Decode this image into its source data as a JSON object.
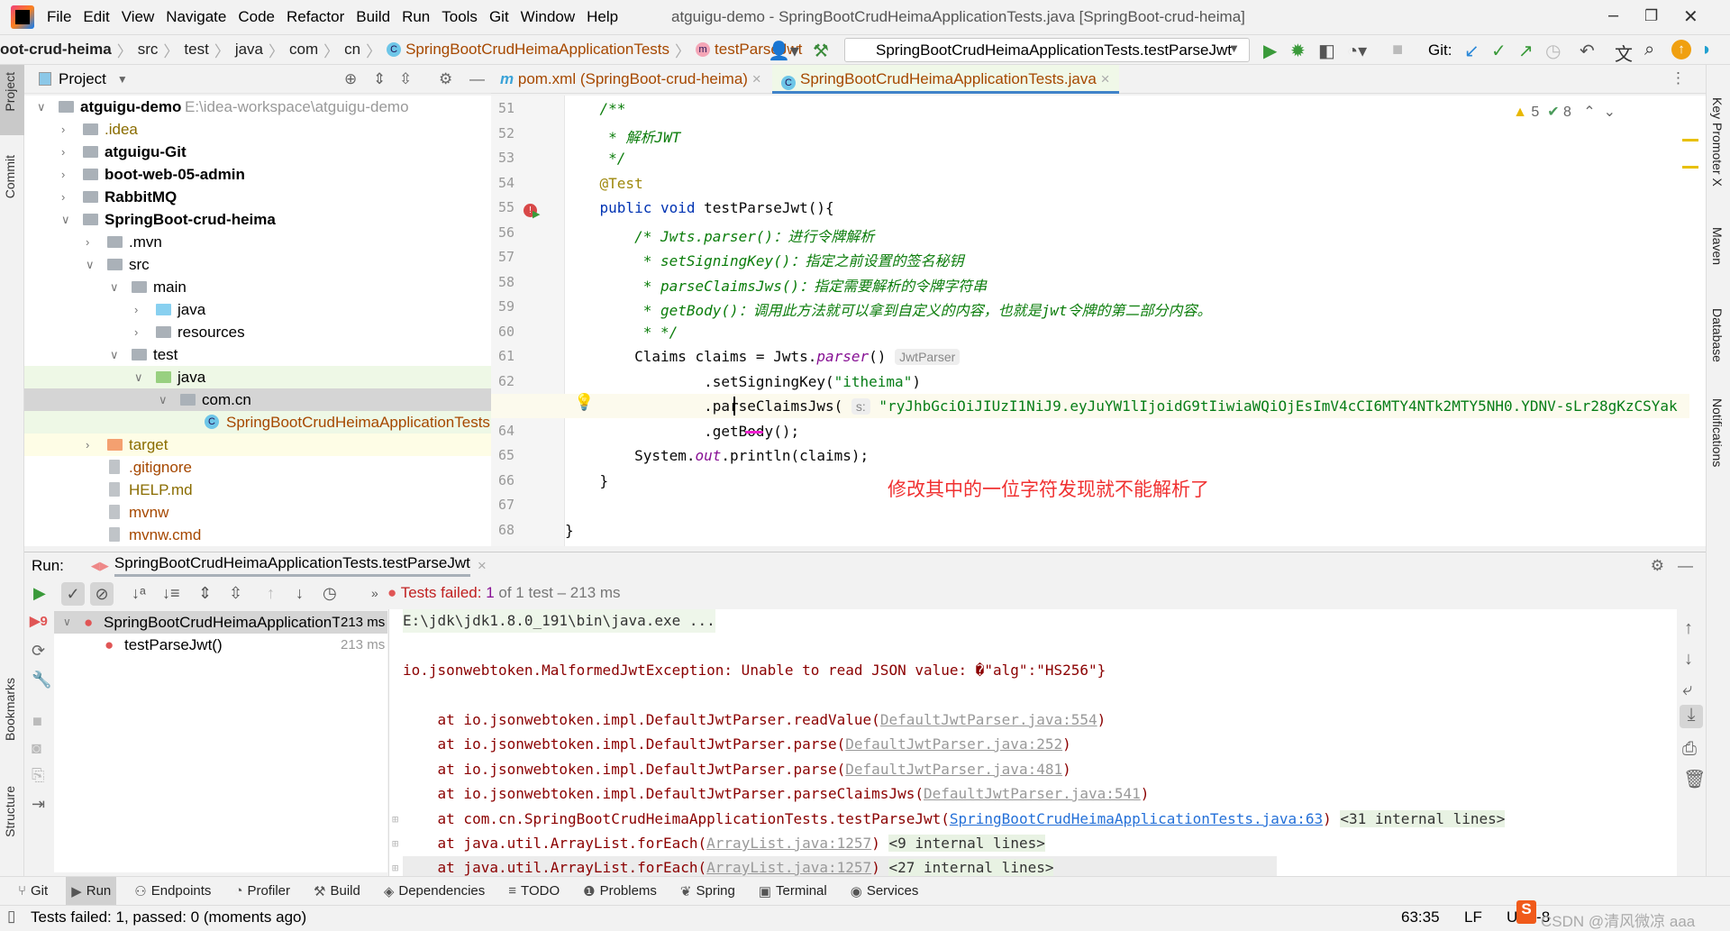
{
  "window": {
    "title": "atguigu-demo - SpringBootCrudHeimaApplicationTests.java [SpringBoot-crud-heima]"
  },
  "menu": [
    "File",
    "Edit",
    "View",
    "Navigate",
    "Code",
    "Refactor",
    "Build",
    "Run",
    "Tools",
    "Git",
    "Window",
    "Help"
  ],
  "breadcrumb": [
    "oot-crud-heima",
    "src",
    "test",
    "java",
    "com",
    "cn",
    "SpringBootCrudHeimaApplicationTests",
    "testParseJwt"
  ],
  "toolbar": {
    "run_config": "SpringBootCrudHeimaApplicationTests.testParseJwt",
    "git_label": "Git:"
  },
  "project": {
    "header": "Project",
    "tree": [
      {
        "label": "atguigu-demo",
        "path": "E:\\idea-workspace\\atguigu-demo",
        "depth": 0,
        "expanded": true,
        "bold": true,
        "icon": "module"
      },
      {
        "label": ".idea",
        "depth": 1,
        "expanded": false,
        "icon": "folder",
        "color": "#8a6c00"
      },
      {
        "label": "atguigu-Git",
        "depth": 1,
        "expanded": false,
        "bold": true,
        "icon": "module"
      },
      {
        "label": "boot-web-05-admin",
        "depth": 1,
        "expanded": false,
        "bold": true,
        "icon": "module"
      },
      {
        "label": "RabbitMQ",
        "depth": 1,
        "expanded": false,
        "bold": true,
        "icon": "module"
      },
      {
        "label": "SpringBoot-crud-heima",
        "depth": 1,
        "expanded": true,
        "bold": true,
        "icon": "module"
      },
      {
        "label": ".mvn",
        "depth": 2,
        "expanded": false,
        "icon": "folder"
      },
      {
        "label": "src",
        "depth": 2,
        "expanded": true,
        "icon": "folder"
      },
      {
        "label": "main",
        "depth": 3,
        "expanded": true,
        "icon": "folder"
      },
      {
        "label": "java",
        "depth": 4,
        "expanded": false,
        "icon": "source-folder"
      },
      {
        "label": "resources",
        "depth": 4,
        "expanded": false,
        "icon": "resources-folder"
      },
      {
        "label": "test",
        "depth": 3,
        "expanded": true,
        "icon": "folder"
      },
      {
        "label": "java",
        "depth": 4,
        "expanded": true,
        "icon": "test-folder",
        "bg": "#eef8e6"
      },
      {
        "label": "com.cn",
        "depth": 5,
        "expanded": true,
        "icon": "package",
        "bg": "#d5d5d5"
      },
      {
        "label": "SpringBootCrudHeimaApplicationTests",
        "depth": 6,
        "icon": "class",
        "color": "#a64800",
        "bg": "#eef8e6"
      },
      {
        "label": "target",
        "depth": 2,
        "expanded": false,
        "icon": "excluded-folder",
        "bg": "#fefde6",
        "color": "#8a6c00"
      },
      {
        "label": ".gitignore",
        "depth": 2,
        "icon": "file",
        "color": "#a64800"
      },
      {
        "label": "HELP.md",
        "depth": 2,
        "icon": "md-file",
        "color": "#8a6c00"
      },
      {
        "label": "mvnw",
        "depth": 2,
        "icon": "script-file",
        "color": "#a64800"
      },
      {
        "label": "mvnw.cmd",
        "depth": 2,
        "icon": "file",
        "color": "#a64800"
      }
    ]
  },
  "editor": {
    "tabs": [
      {
        "label": "pom.xml (SpringBoot-crud-heima)",
        "active": false
      },
      {
        "label": "SpringBootCrudHeimaApplicationTests.java",
        "active": true
      }
    ],
    "warnings": "5",
    "weak_warnings": "8",
    "line_numbers": [
      "51",
      "52",
      "53",
      "54",
      "55",
      "56",
      "57",
      "58",
      "59",
      "60",
      "61",
      "62",
      "63",
      "64",
      "65",
      "66",
      "67",
      "68"
    ],
    "code": {
      "l51": "/**",
      "l52": " * 解析JWT",
      "l53": " */",
      "l54": "@Test",
      "l55a": "public void ",
      "l55b": "testParseJwt(){",
      "l56": "    /* Jwts.parser()：进行令牌解析",
      "l57": "     * setSigningKey()：指定之前设置的签名秘钥",
      "l58": "     * parseClaimsJws()：指定需要解析的令牌字符串",
      "l59": "     * getBody()：调用此方法就可以拿到自定义的内容，也就是jwt令牌的第二部分内容。",
      "l60": "     * */",
      "l61a": "    Claims claims = Jwts.",
      "l61b": "parser",
      "l61c": "()",
      "l61hint": "JwtParser",
      "l62a": "            .setSigningKey(",
      "l62b": "\"itheima\"",
      "l62c": ")",
      "l63a": "            .parseClaimsJws(",
      "l63hint": "s:",
      "l63b": "\"ryJhbGciOiJIUzI1NiJ9.eyJuYW1lIjoidG9tIiwiaWQiOjEsImV4cCI6MTY4NTk2MTY5NH0.YDNV-sLr28gKzCSYak",
      "l64": "            .getBody();",
      "l65a": "    System.",
      "l65b": "out",
      "l65c": ".println(claims);",
      "l66": "}",
      "l68": "}"
    },
    "annotation_note": "修改其中的一位字符发现就不能解析了"
  },
  "run": {
    "label": "Run:",
    "tab": "SpringBootCrudHeimaApplicationTests.testParseJwt",
    "status_prefix": "Tests failed:",
    "status_count": "1",
    "status_rest": "of 1 test – 213 ms",
    "tree": [
      {
        "label": "SpringBootCrudHeimaApplicationTe",
        "time": "213 ms",
        "status": "failed"
      },
      {
        "label": "testParseJwt()",
        "time": "213 ms",
        "status": "failed"
      }
    ],
    "console": [
      {
        "text": "E:\\jdk\\jdk1.8.0_191\\bin\\java.exe ..."
      },
      {
        "text": "io.jsonwebtoken.MalformedJwtException: Unable to read JSON value: �\"alg\":\"HS256\"}"
      },
      {
        "pre": "    at io.jsonwebtoken.impl.DefaultJwtParser.readValue(",
        "link": "DefaultJwtParser.java:554",
        "post": ")"
      },
      {
        "pre": "    at io.jsonwebtoken.impl.DefaultJwtParser.parse(",
        "link": "DefaultJwtParser.java:252",
        "post": ")"
      },
      {
        "pre": "    at io.jsonwebtoken.impl.DefaultJwtParser.parse(",
        "link": "DefaultJwtParser.java:481",
        "post": ")"
      },
      {
        "pre": "    at io.jsonwebtoken.impl.DefaultJwtParser.parseClaimsJws(",
        "link": "DefaultJwtParser.java:541",
        "post": ")"
      },
      {
        "pre": "    at com.cn.SpringBootCrudHeimaApplicationTests.testParseJwt(",
        "link": "SpringBootCrudHeimaApplicationTests.java:63",
        "post": ") ",
        "fold": "<31 internal lines>"
      },
      {
        "pre": "    at java.util.ArrayList.forEach(",
        "link": "ArrayList.java:1257",
        "post": ") ",
        "fold": "<9 internal lines>"
      },
      {
        "pre": "    at java.util.ArrayList.forEach(",
        "link": "ArrayList.java:1257",
        "post": ") ",
        "fold": "<27 internal lines>"
      }
    ]
  },
  "bottom_tools": [
    "Git",
    "Run",
    "Endpoints",
    "Profiler",
    "Build",
    "Dependencies",
    "TODO",
    "Problems",
    "Spring",
    "Terminal",
    "Services"
  ],
  "left_tools": [
    "Project",
    "Commit",
    "Bookmarks",
    "Structure"
  ],
  "right_tools": [
    "Key Promoter X",
    "Maven",
    "Database",
    "Notifications"
  ],
  "status": {
    "message": "Tests failed: 1, passed: 0 (moments ago)",
    "position": "63:35",
    "line_sep": "LF",
    "encoding": "UTF-8"
  },
  "watermark": "CSDN @清风微凉 aaa",
  "colors": {
    "accent": "#4083c9",
    "error": "#e05555",
    "note": "#f03030"
  }
}
